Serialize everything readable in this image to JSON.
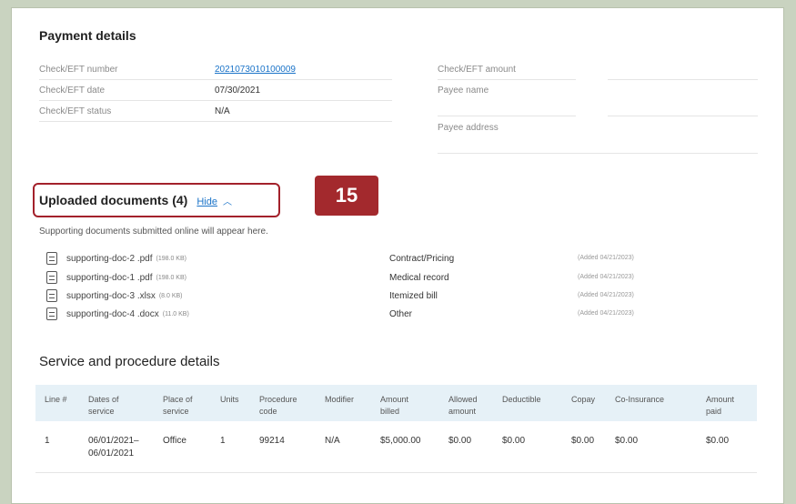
{
  "payment": {
    "title": "Payment details",
    "left_rows": [
      {
        "label": "Check/EFT number",
        "value": "2021073010100009"
      },
      {
        "label": "Check/EFT date",
        "value": "07/30/2021"
      },
      {
        "label": "Check/EFT status",
        "value": "N/A"
      }
    ],
    "right_rows": [
      {
        "label": "Check/EFT amount"
      },
      {
        "label": "Payee name"
      },
      {
        "label": "Payee address"
      }
    ]
  },
  "uploaded": {
    "title": "Uploaded documents (4)",
    "toggle_label": "Hide",
    "subtitle": "Supporting documents submitted online will appear here.",
    "docs": [
      {
        "name": "supporting-doc-2 .pdf",
        "size": "(198.0 KB)",
        "type": "Contract/Pricing",
        "added": "(Added 04/21/2023)",
        "icon": "pdf-file-icon"
      },
      {
        "name": "supporting-doc-1 .pdf",
        "size": "(198.0 KB)",
        "type": "Medical record",
        "added": "(Added 04/21/2023)",
        "icon": "pdf-file-icon"
      },
      {
        "name": "supporting-doc-3 .xlsx",
        "size": "(8.0 KB)",
        "type": "Itemized bill",
        "added": "(Added 04/21/2023)",
        "icon": "spreadsheet-file-icon"
      },
      {
        "name": "supporting-doc-4 .docx",
        "size": "(11.0 KB)",
        "type": "Other",
        "added": "(Added 04/21/2023)",
        "icon": "word-file-icon"
      }
    ]
  },
  "step_badge": "15",
  "service": {
    "title": "Service and procedure details",
    "headers": [
      "Line #",
      "Dates of service",
      "Place of service",
      "Units",
      "Procedure code",
      "Modifier",
      "Amount billed",
      "Allowed amount",
      "Deductible",
      "Copay",
      "Co-Insurance",
      "Amount paid"
    ],
    "rows": [
      [
        "1",
        "06/01/2021– 06/01/2021",
        "Office",
        "1",
        "99214",
        "N/A",
        "$5,000.00",
        "$0.00",
        "$0.00",
        "$0.00",
        "$0.00",
        "$0.00"
      ]
    ]
  },
  "colors": {
    "accent": "#1a73c8",
    "badge": "#a3292d",
    "header_bg": "#e6f1f7"
  }
}
